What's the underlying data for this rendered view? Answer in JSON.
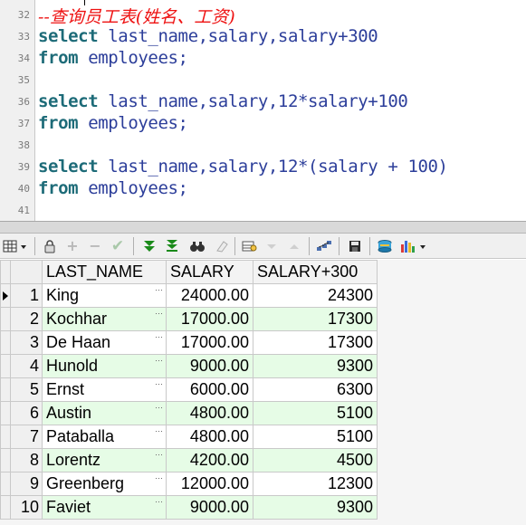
{
  "editor": {
    "lines": [
      {
        "num": "32",
        "type": "comment",
        "text": "--查询员工表(姓名、工资)"
      },
      {
        "num": "33",
        "type": "code",
        "keyword": "select",
        "rest": " last_name,salary,salary+300"
      },
      {
        "num": "34",
        "type": "code",
        "keyword": "from",
        "rest": " employees;"
      },
      {
        "num": "35",
        "type": "blank"
      },
      {
        "num": "36",
        "type": "code",
        "keyword": "select",
        "rest": " last_name,salary,12*salary+100"
      },
      {
        "num": "37",
        "type": "code",
        "keyword": "from",
        "rest": " employees;"
      },
      {
        "num": "38",
        "type": "blank"
      },
      {
        "num": "39",
        "type": "code",
        "keyword": "select",
        "rest": " last_name,salary,12*(salary + 100)"
      },
      {
        "num": "40",
        "type": "code",
        "keyword": "from",
        "rest": " employees;"
      },
      {
        "num": "41",
        "type": "blank"
      }
    ]
  },
  "toolbar": {
    "icons": [
      "grid-view-icon",
      "lock-icon",
      "add-record-icon",
      "delete-record-icon",
      "post-record-icon",
      "fetch-next-icon",
      "fetch-all-icon",
      "find-icon",
      "clear-icon",
      "query-by-example-icon",
      "previous-icon",
      "next-icon",
      "export-icon",
      "save-icon",
      "connection-icon",
      "chart-icon"
    ]
  },
  "grid": {
    "columns": [
      "LAST_NAME",
      "SALARY",
      "SALARY+300"
    ],
    "rows": [
      {
        "n": "1",
        "last_name": "King",
        "salary": "24000.00",
        "salary300": "24300"
      },
      {
        "n": "2",
        "last_name": "Kochhar",
        "salary": "17000.00",
        "salary300": "17300"
      },
      {
        "n": "3",
        "last_name": "De Haan",
        "salary": "17000.00",
        "salary300": "17300"
      },
      {
        "n": "4",
        "last_name": "Hunold",
        "salary": "9000.00",
        "salary300": "9300"
      },
      {
        "n": "5",
        "last_name": "Ernst",
        "salary": "6000.00",
        "salary300": "6300"
      },
      {
        "n": "6",
        "last_name": "Austin",
        "salary": "4800.00",
        "salary300": "5100"
      },
      {
        "n": "7",
        "last_name": "Pataballa",
        "salary": "4800.00",
        "salary300": "5100"
      },
      {
        "n": "8",
        "last_name": "Lorentz",
        "salary": "4200.00",
        "salary300": "4500"
      },
      {
        "n": "9",
        "last_name": "Greenberg",
        "salary": "12000.00",
        "salary300": "12300"
      },
      {
        "n": "10",
        "last_name": "Faviet",
        "salary": "9000.00",
        "salary300": "9300"
      }
    ],
    "cell_ellipsis": "···"
  },
  "colors": {
    "keyword": "#1d6b78",
    "identifier": "#2c3e9a",
    "comment": "#ee1111",
    "alt_row": "#e6fce6"
  }
}
